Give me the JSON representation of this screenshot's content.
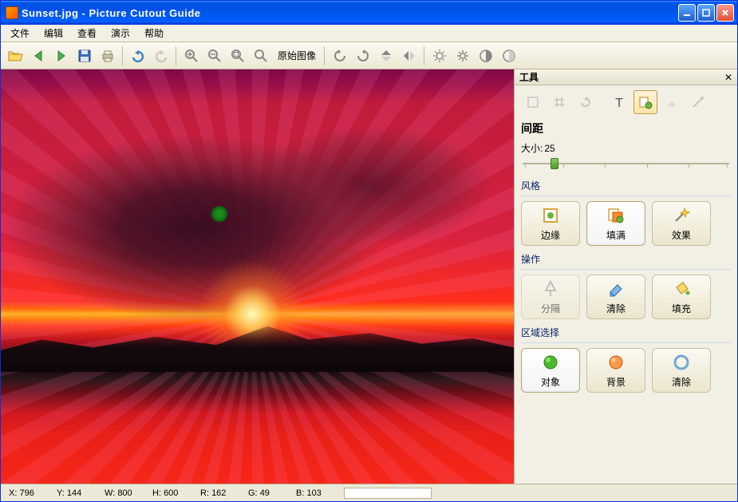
{
  "titlebar": {
    "title": "Sunset.jpg - Picture Cutout Guide"
  },
  "menu": {
    "file": "文件",
    "edit": "编辑",
    "view": "查看",
    "demo": "演示",
    "help": "帮助"
  },
  "toolbar": {
    "original_label": "原始图像"
  },
  "panel": {
    "header": "工具",
    "section_title": "间距",
    "size_label": "大小:",
    "size_value": "25",
    "group_style": "风格",
    "group_operation": "操作",
    "group_region": "区域选择",
    "style": {
      "edge": "边缘",
      "fill": "填满",
      "effect": "效果"
    },
    "op": {
      "split": "分隔",
      "clear": "清除",
      "fillop": "填充"
    },
    "region": {
      "object": "对象",
      "background": "背景",
      "clear": "清除"
    }
  },
  "status": {
    "x_label": "X:",
    "x_val": "796",
    "y_label": "Y:",
    "y_val": "144",
    "w_label": "W:",
    "w_val": "800",
    "h_label": "H:",
    "h_val": "600",
    "r_label": "R:",
    "r_val": "162",
    "g_label": "G:",
    "g_val": "49",
    "b_label": "B:",
    "b_val": "103"
  }
}
